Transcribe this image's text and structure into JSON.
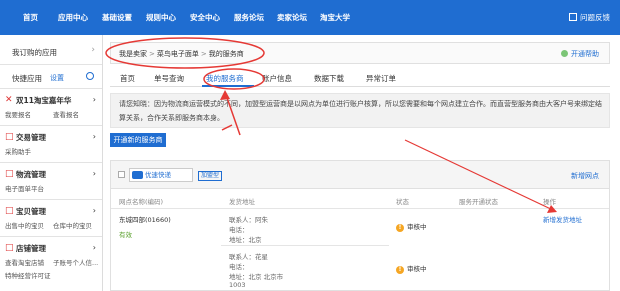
{
  "topnav": {
    "items": [
      "首页",
      "应用中心",
      "基础设置",
      "规则中心",
      "安全中心",
      "服务论坛",
      "卖家论坛",
      "淘宝大学"
    ],
    "help": "问题反馈"
  },
  "sidebar": {
    "my_apps": "我订购的应用",
    "quick_apps": "快捷应用",
    "settings": "设置",
    "sections": [
      {
        "icon": "✕",
        "title": "双11淘宝嘉年华",
        "subs": [
          "我要报名",
          "查看报名"
        ]
      },
      {
        "icon": "□",
        "title": "交易管理",
        "subs": [
          "采购助手",
          ""
        ]
      },
      {
        "icon": "□",
        "title": "物流管理",
        "subs": [
          "电子面单平台",
          ""
        ]
      },
      {
        "icon": "□",
        "title": "宝贝管理",
        "subs": [
          "出售中的宝贝",
          "仓库中的宝贝"
        ]
      },
      {
        "icon": "□",
        "title": "店铺管理",
        "subs": [
          "查看淘宝店铺",
          "子账号个人信..."
        ],
        "extra": "特种经营许可证"
      }
    ]
  },
  "breadcrumb": [
    "我是卖家",
    "菜鸟电子面单",
    "我的服务商"
  ],
  "open_help": "开通帮助",
  "tabs": [
    "首页",
    "单号查询",
    "我的服务商",
    "账户信息",
    "数据下载",
    "异常订单"
  ],
  "notice": {
    "line1": "请您知晓：因为物流商运营模式的不同，加盟型运营商是以网点为单位进行账户核算，所以您需要和每个网点建立合作。而直营型服务商由大客户号来绑定结",
    "line2": "算关系，合作关系即服务商本身。"
  },
  "open_button": "开通新的服务商",
  "provider": {
    "logo_text": "优速快递",
    "badge": "加盟型",
    "new_network": "新增网点",
    "columns": [
      "网点名称(编码)",
      "发货地址",
      "状态",
      "服务开通状态",
      "操作"
    ],
    "network_name": "东城四部(01660)",
    "network_status": "有效",
    "addresses": [
      {
        "contact": "联系人：阿朱",
        "phone": "电话：",
        "address": "地址：北京",
        "status": "审核中"
      },
      {
        "contact": "联系人：花星",
        "phone": "电话：",
        "address": "地址：北京 北京市",
        "address2": "1003",
        "status": "审核中"
      }
    ],
    "action": "新增发货地址"
  },
  "colors": {
    "brand": "#1f6dd1",
    "annotation": "#e53935"
  }
}
